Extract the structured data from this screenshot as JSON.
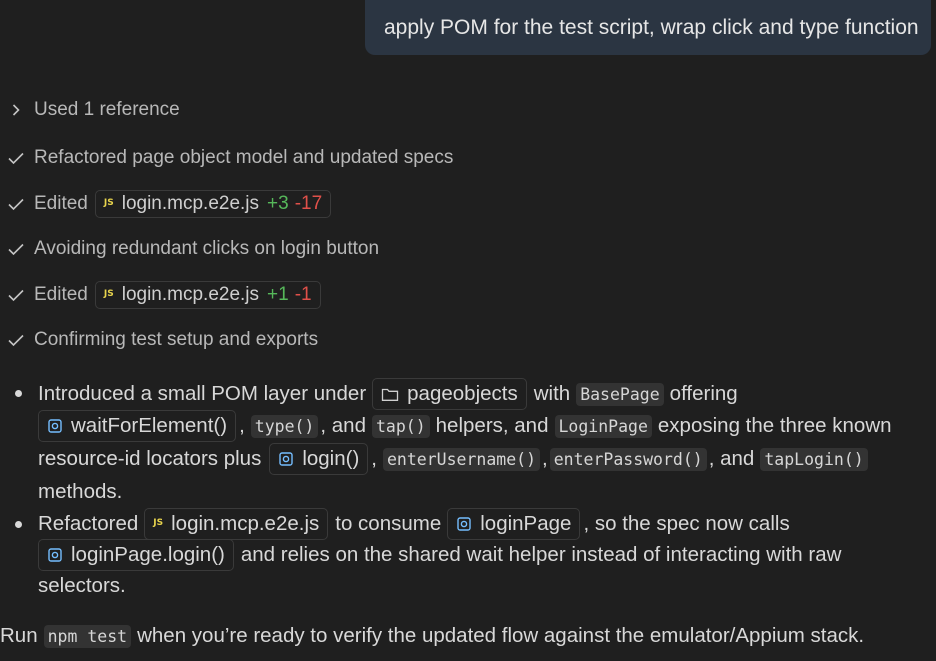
{
  "user_message": "apply POM for the test script, wrap click and type function",
  "steps": [
    {
      "icon": "chevron-right-icon",
      "text": "Used 1 reference"
    },
    {
      "icon": "check-icon",
      "text": "Refactored page object model and updated specs"
    },
    {
      "icon": "check-icon",
      "text": "Edited",
      "file": {
        "icon": "js-file-icon",
        "icon_label": "JS",
        "name": "login.mcp.e2e.js",
        "added": "+3",
        "removed": "-17"
      }
    },
    {
      "icon": "check-icon",
      "text": "Avoiding redundant clicks on login button"
    },
    {
      "icon": "check-icon",
      "text": "Edited",
      "file": {
        "icon": "js-file-icon",
        "icon_label": "JS",
        "name": "login.mcp.e2e.js",
        "added": "+1",
        "removed": "-1"
      }
    },
    {
      "icon": "check-icon",
      "text": "Confirming test setup and exports"
    }
  ],
  "bullet1": {
    "t1": "Introduced a small POM layer under",
    "folder": "pageobjects",
    "t2": "with",
    "c_basepage": "BasePage",
    "t3": "offering",
    "sym_wait": "waitForElement()",
    "t4": ",",
    "c_type": "type()",
    "t5": ", and",
    "c_tap": "tap()",
    "t6": "helpers, and",
    "c_loginpage": "LoginPage",
    "t7": "exposing the three known",
    "t8": "resource-id locators plus",
    "sym_login": "login()",
    "t9": ",",
    "c_enteruser": "enterUsername()",
    "t10": ",",
    "c_enterpass": "enterPassword()",
    "t11": ", and",
    "c_taplogin": "tapLogin()",
    "t12": "methods."
  },
  "bullet2": {
    "t1": "Refactored",
    "file": "login.mcp.e2e.js",
    "file_icon_label": "JS",
    "t2": "to consume",
    "sym_loginpage": "loginPage",
    "t3": ", so the spec now calls",
    "sym_loginpage_login": "loginPage.login()",
    "t4": "and relies on the shared wait helper instead of interacting with raw",
    "t5": "selectors."
  },
  "footer": {
    "t1": "Run",
    "code": "npm test",
    "t2": "when you’re ready to verify the updated flow against the emulator/Appium stack."
  },
  "colors": {
    "background": "#1f1f1f",
    "bubble": "#2b3542",
    "added": "#56b85a",
    "removed": "#e0504a",
    "js_icon": "#e8d44d",
    "symbol_icon": "#75beff"
  }
}
